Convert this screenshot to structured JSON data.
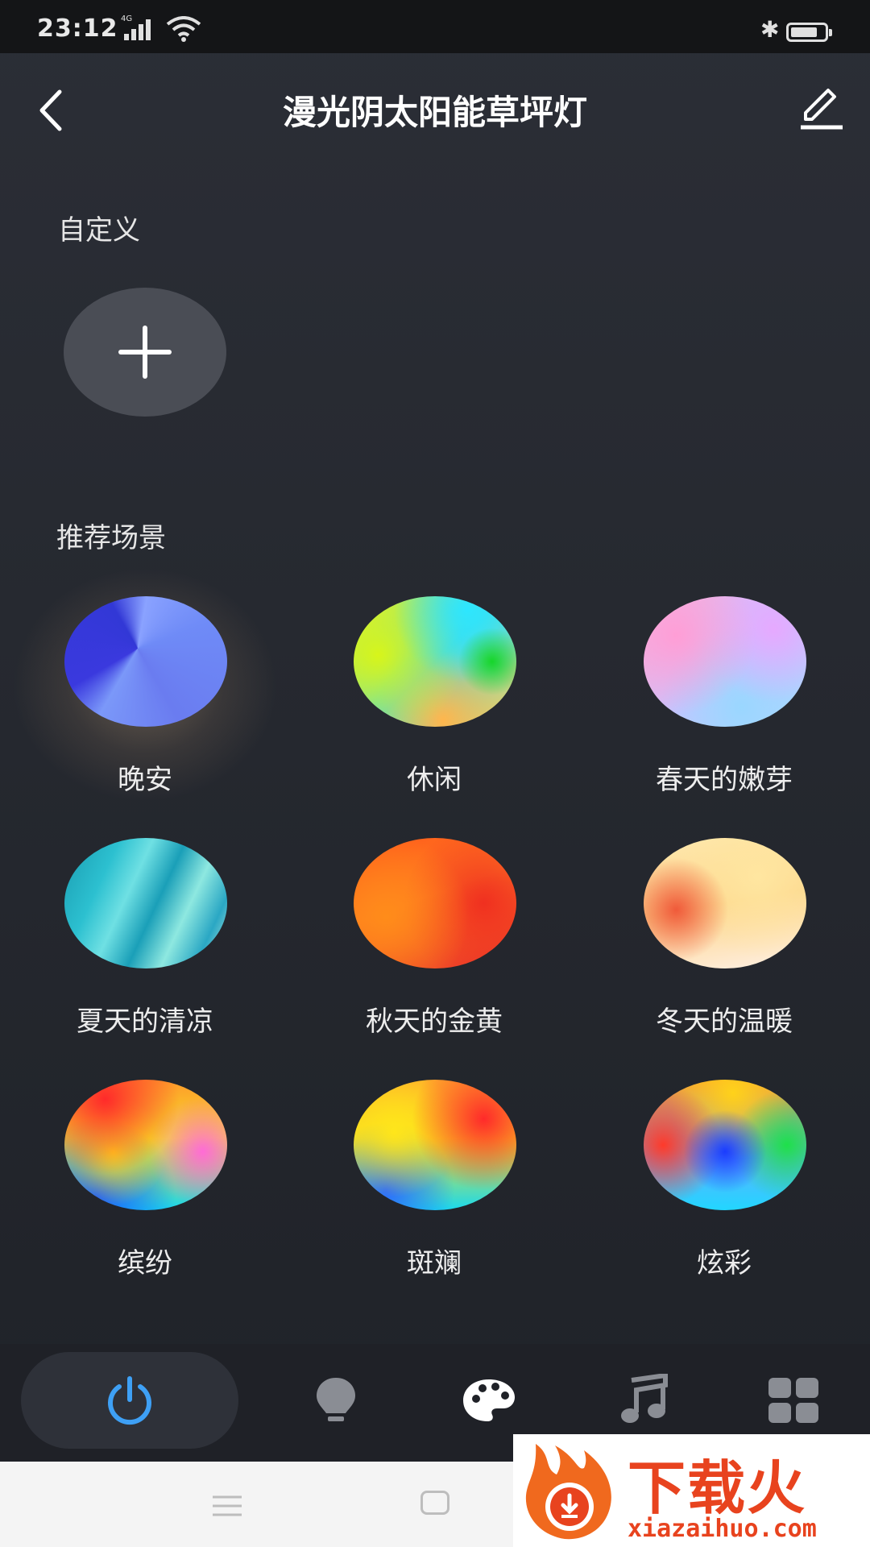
{
  "status_bar": {
    "time": "23:12",
    "network": "4G",
    "battery_level": 0.8
  },
  "header": {
    "title": "漫光阴太阳能草坪灯"
  },
  "custom_section": {
    "title": "自定义"
  },
  "recommended_section": {
    "title": "推荐场景",
    "scenes": [
      {
        "label": "晚安"
      },
      {
        "label": "休闲"
      },
      {
        "label": "春天的嫩芽"
      },
      {
        "label": "夏天的清凉"
      },
      {
        "label": "秋天的金黄"
      },
      {
        "label": "冬天的温暖"
      },
      {
        "label": "缤纷"
      },
      {
        "label": "斑斓"
      },
      {
        "label": "炫彩"
      }
    ]
  },
  "bottom_nav": {
    "items": [
      {
        "icon": "power-icon",
        "active": true,
        "color": "#3ea0f5"
      },
      {
        "icon": "bulb-icon",
        "active": false
      },
      {
        "icon": "palette-icon",
        "active": false
      },
      {
        "icon": "music-icon",
        "active": false
      },
      {
        "icon": "grid-icon",
        "active": false
      }
    ]
  },
  "watermark": {
    "brand": "下载火",
    "url": "xiazaihuo.com"
  }
}
